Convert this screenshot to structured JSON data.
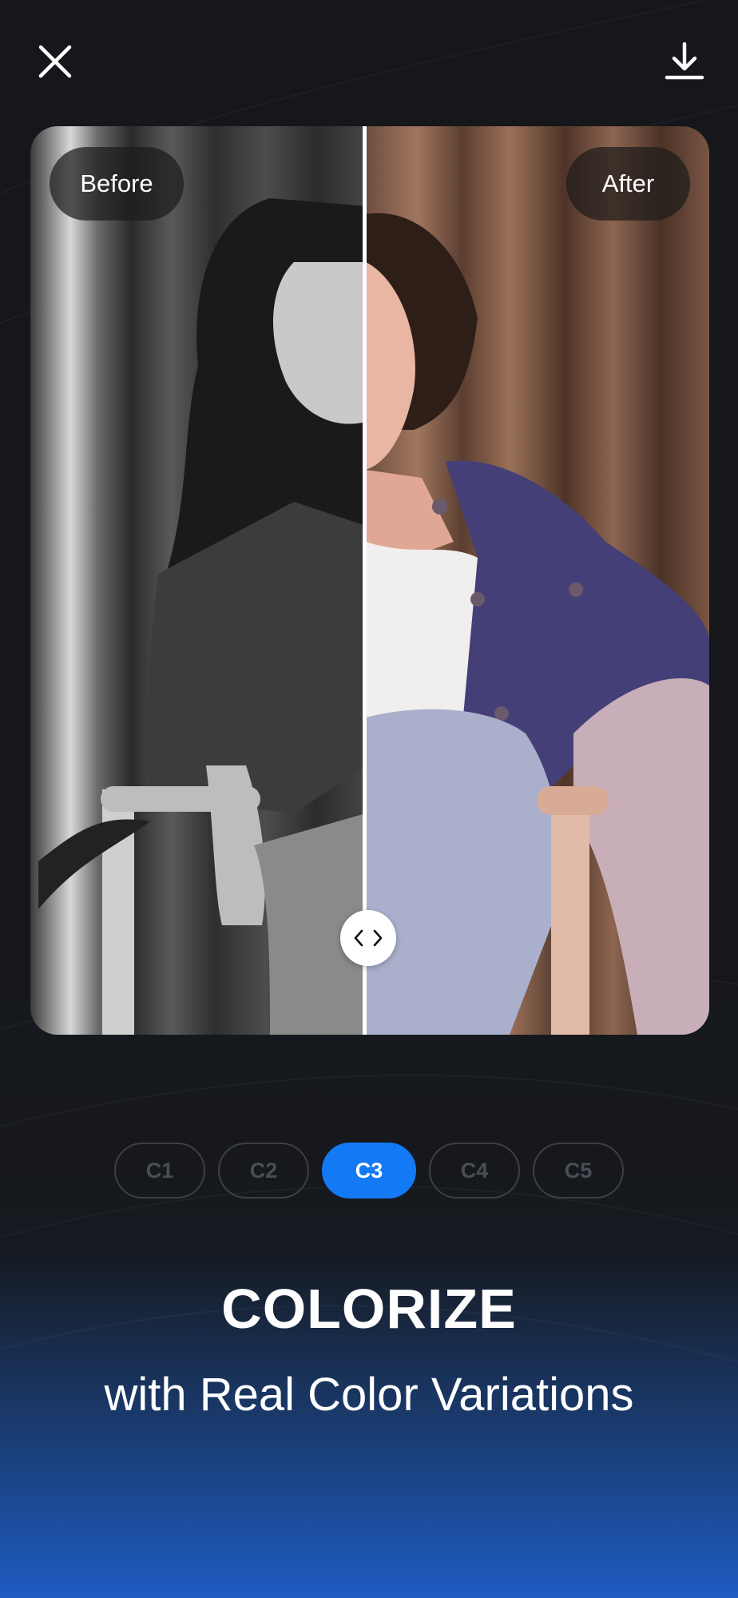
{
  "header": {
    "close_icon": "close-icon",
    "download_icon": "download-icon"
  },
  "compare": {
    "before_label": "Before",
    "after_label": "After",
    "handle_icon": "chevrons-left-right-icon",
    "split_position": 0.49
  },
  "variants": [
    {
      "label": "C1",
      "active": false
    },
    {
      "label": "C2",
      "active": false
    },
    {
      "label": "C3",
      "active": true
    },
    {
      "label": "C4",
      "active": false
    },
    {
      "label": "C5",
      "active": false
    }
  ],
  "promo": {
    "title": "COLORIZE",
    "subtitle": "with Real Color Variations"
  },
  "colors": {
    "accent": "#1479f5",
    "background": "#15171b",
    "gradient_bottom": "#1e5cc2"
  }
}
